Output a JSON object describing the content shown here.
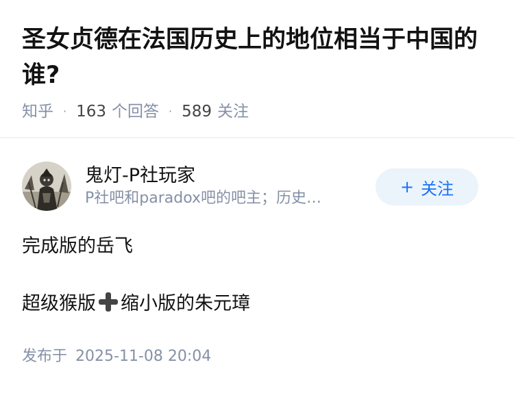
{
  "question": {
    "title": "圣女贞德在法国历史上的地位相当于中国的谁?",
    "source": "知乎",
    "answer_count": "163",
    "answer_label": "个回答",
    "follower_count": "589",
    "follower_label": "关注"
  },
  "answer": {
    "author": {
      "name": "鬼灯-P社玩家",
      "bio": "P社吧和paradox吧的吧主；历史…",
      "avatar_icon": "avatar-illustration"
    },
    "follow_button": {
      "icon": "+",
      "label": "关注"
    },
    "paragraphs": {
      "p1": "完成版的岳飞",
      "p2_before": "超级猴版",
      "p2_emoji": "plus-emoji",
      "p2_after": "缩小版的朱元璋"
    },
    "published_label": "发布于",
    "published_time": "2025-11-08 20:04"
  },
  "colors": {
    "accent": "#1772f6",
    "follow_bg": "#ebf3fb",
    "meta": "#8590a6",
    "text": "#121212"
  }
}
